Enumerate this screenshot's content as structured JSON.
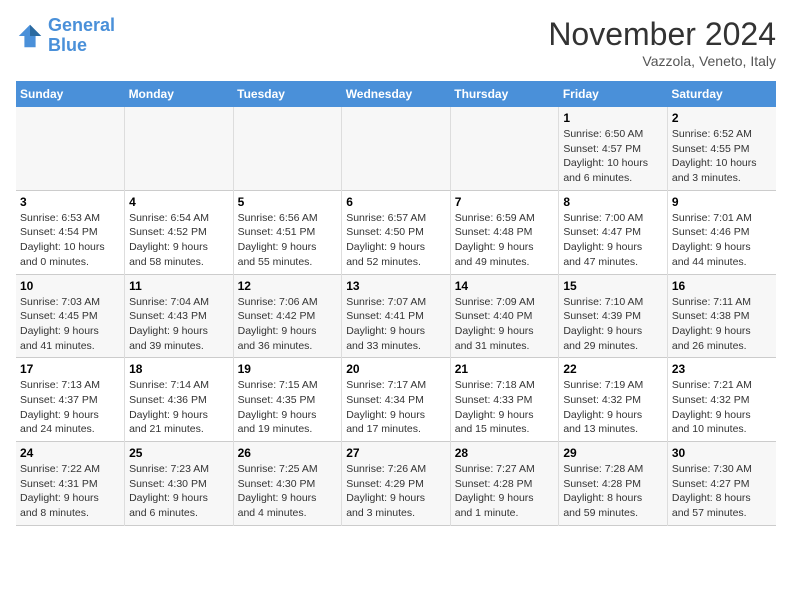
{
  "header": {
    "logo_line1": "General",
    "logo_line2": "Blue",
    "month": "November 2024",
    "location": "Vazzola, Veneto, Italy"
  },
  "weekdays": [
    "Sunday",
    "Monday",
    "Tuesday",
    "Wednesday",
    "Thursday",
    "Friday",
    "Saturday"
  ],
  "weeks": [
    [
      {
        "day": "",
        "info": ""
      },
      {
        "day": "",
        "info": ""
      },
      {
        "day": "",
        "info": ""
      },
      {
        "day": "",
        "info": ""
      },
      {
        "day": "",
        "info": ""
      },
      {
        "day": "1",
        "info": "Sunrise: 6:50 AM\nSunset: 4:57 PM\nDaylight: 10 hours\nand 6 minutes."
      },
      {
        "day": "2",
        "info": "Sunrise: 6:52 AM\nSunset: 4:55 PM\nDaylight: 10 hours\nand 3 minutes."
      }
    ],
    [
      {
        "day": "3",
        "info": "Sunrise: 6:53 AM\nSunset: 4:54 PM\nDaylight: 10 hours\nand 0 minutes."
      },
      {
        "day": "4",
        "info": "Sunrise: 6:54 AM\nSunset: 4:52 PM\nDaylight: 9 hours\nand 58 minutes."
      },
      {
        "day": "5",
        "info": "Sunrise: 6:56 AM\nSunset: 4:51 PM\nDaylight: 9 hours\nand 55 minutes."
      },
      {
        "day": "6",
        "info": "Sunrise: 6:57 AM\nSunset: 4:50 PM\nDaylight: 9 hours\nand 52 minutes."
      },
      {
        "day": "7",
        "info": "Sunrise: 6:59 AM\nSunset: 4:48 PM\nDaylight: 9 hours\nand 49 minutes."
      },
      {
        "day": "8",
        "info": "Sunrise: 7:00 AM\nSunset: 4:47 PM\nDaylight: 9 hours\nand 47 minutes."
      },
      {
        "day": "9",
        "info": "Sunrise: 7:01 AM\nSunset: 4:46 PM\nDaylight: 9 hours\nand 44 minutes."
      }
    ],
    [
      {
        "day": "10",
        "info": "Sunrise: 7:03 AM\nSunset: 4:45 PM\nDaylight: 9 hours\nand 41 minutes."
      },
      {
        "day": "11",
        "info": "Sunrise: 7:04 AM\nSunset: 4:43 PM\nDaylight: 9 hours\nand 39 minutes."
      },
      {
        "day": "12",
        "info": "Sunrise: 7:06 AM\nSunset: 4:42 PM\nDaylight: 9 hours\nand 36 minutes."
      },
      {
        "day": "13",
        "info": "Sunrise: 7:07 AM\nSunset: 4:41 PM\nDaylight: 9 hours\nand 33 minutes."
      },
      {
        "day": "14",
        "info": "Sunrise: 7:09 AM\nSunset: 4:40 PM\nDaylight: 9 hours\nand 31 minutes."
      },
      {
        "day": "15",
        "info": "Sunrise: 7:10 AM\nSunset: 4:39 PM\nDaylight: 9 hours\nand 29 minutes."
      },
      {
        "day": "16",
        "info": "Sunrise: 7:11 AM\nSunset: 4:38 PM\nDaylight: 9 hours\nand 26 minutes."
      }
    ],
    [
      {
        "day": "17",
        "info": "Sunrise: 7:13 AM\nSunset: 4:37 PM\nDaylight: 9 hours\nand 24 minutes."
      },
      {
        "day": "18",
        "info": "Sunrise: 7:14 AM\nSunset: 4:36 PM\nDaylight: 9 hours\nand 21 minutes."
      },
      {
        "day": "19",
        "info": "Sunrise: 7:15 AM\nSunset: 4:35 PM\nDaylight: 9 hours\nand 19 minutes."
      },
      {
        "day": "20",
        "info": "Sunrise: 7:17 AM\nSunset: 4:34 PM\nDaylight: 9 hours\nand 17 minutes."
      },
      {
        "day": "21",
        "info": "Sunrise: 7:18 AM\nSunset: 4:33 PM\nDaylight: 9 hours\nand 15 minutes."
      },
      {
        "day": "22",
        "info": "Sunrise: 7:19 AM\nSunset: 4:32 PM\nDaylight: 9 hours\nand 13 minutes."
      },
      {
        "day": "23",
        "info": "Sunrise: 7:21 AM\nSunset: 4:32 PM\nDaylight: 9 hours\nand 10 minutes."
      }
    ],
    [
      {
        "day": "24",
        "info": "Sunrise: 7:22 AM\nSunset: 4:31 PM\nDaylight: 9 hours\nand 8 minutes."
      },
      {
        "day": "25",
        "info": "Sunrise: 7:23 AM\nSunset: 4:30 PM\nDaylight: 9 hours\nand 6 minutes."
      },
      {
        "day": "26",
        "info": "Sunrise: 7:25 AM\nSunset: 4:30 PM\nDaylight: 9 hours\nand 4 minutes."
      },
      {
        "day": "27",
        "info": "Sunrise: 7:26 AM\nSunset: 4:29 PM\nDaylight: 9 hours\nand 3 minutes."
      },
      {
        "day": "28",
        "info": "Sunrise: 7:27 AM\nSunset: 4:28 PM\nDaylight: 9 hours\nand 1 minute."
      },
      {
        "day": "29",
        "info": "Sunrise: 7:28 AM\nSunset: 4:28 PM\nDaylight: 8 hours\nand 59 minutes."
      },
      {
        "day": "30",
        "info": "Sunrise: 7:30 AM\nSunset: 4:27 PM\nDaylight: 8 hours\nand 57 minutes."
      }
    ]
  ]
}
